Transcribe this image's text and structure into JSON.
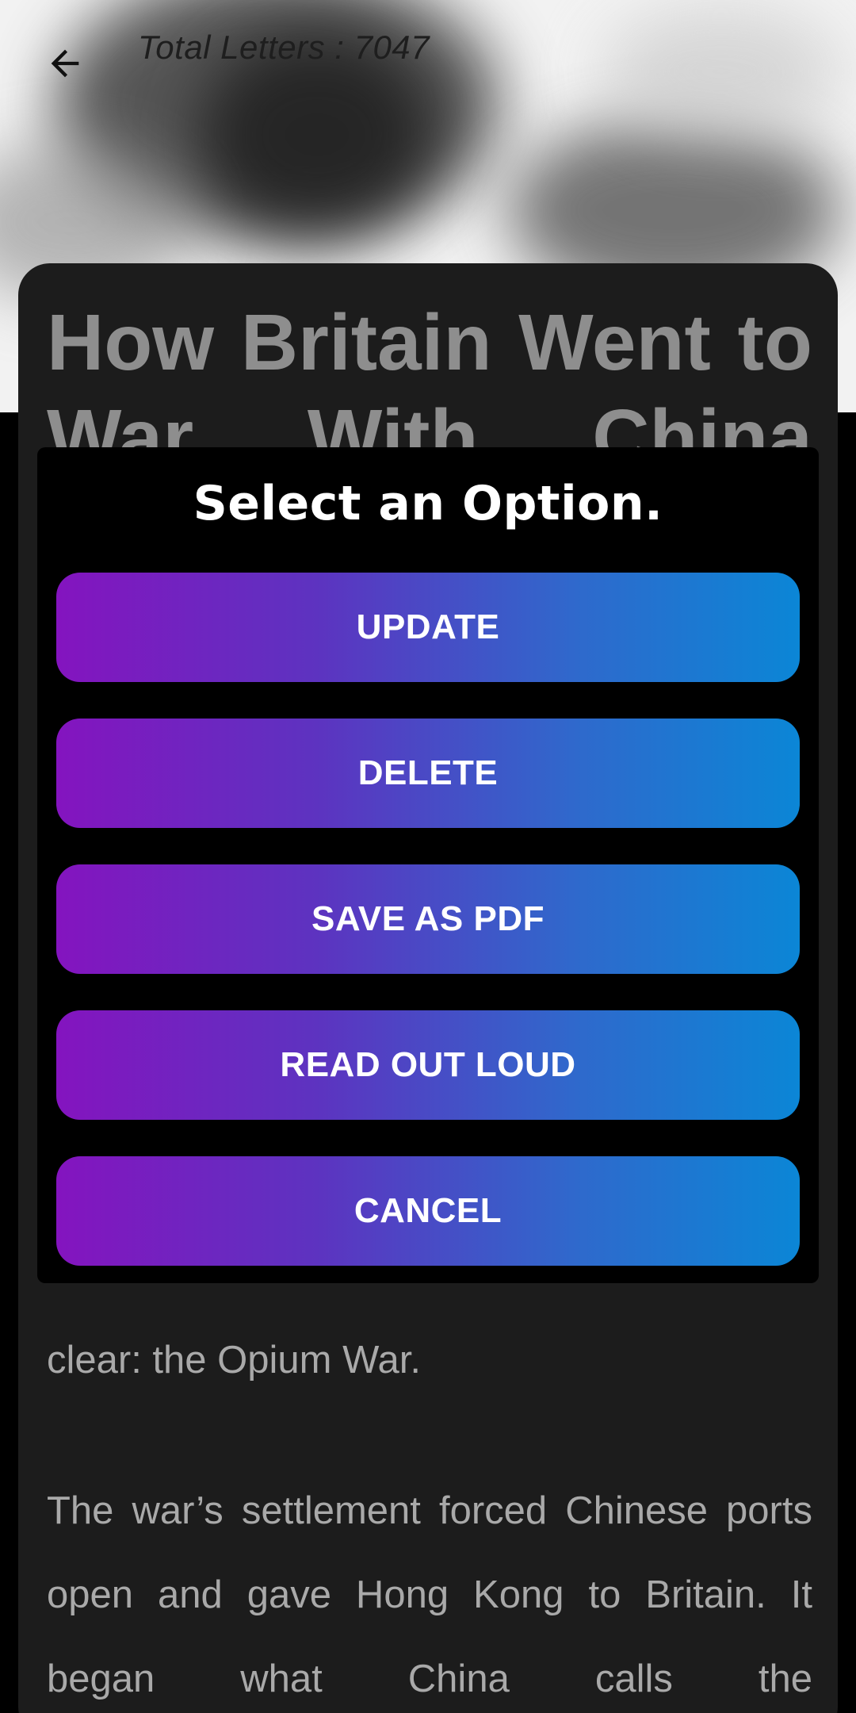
{
  "header": {
    "total_letters": "Total Letters : 7047",
    "back_icon": "arrow-left-icon"
  },
  "article": {
    "title": "How Britain Went to War With China",
    "paragraph_1_tail": "clear: the Opium War.",
    "paragraph_2": "The war’s settlement forced Chinese ports open and gave Hong Kong to Britain. It began what China calls the"
  },
  "dialog": {
    "title": "Select an Option.",
    "options": [
      {
        "label": "UPDATE"
      },
      {
        "label": "DELETE"
      },
      {
        "label": "SAVE AS PDF"
      },
      {
        "label": "READ OUT LOUD"
      },
      {
        "label": "CANCEL"
      }
    ],
    "gradient_colors": [
      "#8414bf",
      "#0b86d6"
    ]
  }
}
